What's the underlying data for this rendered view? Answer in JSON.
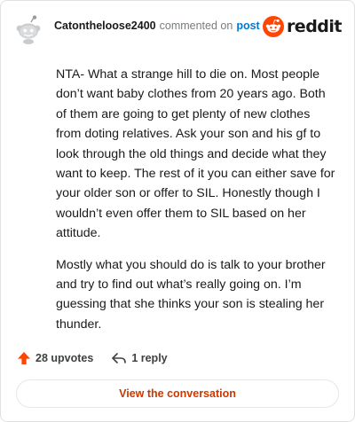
{
  "header": {
    "username": "Catontheloose2400",
    "action_text": "commented on",
    "post_link": "post",
    "brand_word": "reddit"
  },
  "comment": {
    "paragraphs": [
      "NTA- What a strange hill to die on. Most people don’t want baby clothes from 20 years ago. Both of them are going to get plenty of new clothes from doting relatives. Ask your son and his gf to look through the old things and decide what they want to keep. The rest of it you can either save for your older son or offer to SIL. Honestly though I wouldn’t even offer them to SIL based on her attitude.",
      "Mostly what you should do is talk to your brother and try to find out what’s really going on. I’m guessing that she thinks your son is stealing her thunder."
    ]
  },
  "actions": {
    "upvotes": "28 upvotes",
    "replies": "1 reply"
  },
  "cta": {
    "label": "View the conversation"
  },
  "colors": {
    "brand_orange": "#ff4500",
    "link_blue": "#0079d3",
    "cta_text": "#cc3700",
    "upvote_arrow": "#ff4500"
  },
  "icons": {
    "avatar": "snoo-avatar-icon",
    "brand": "reddit-logo-icon",
    "upvote": "upvote-arrow-icon",
    "reply": "reply-arrow-icon"
  }
}
